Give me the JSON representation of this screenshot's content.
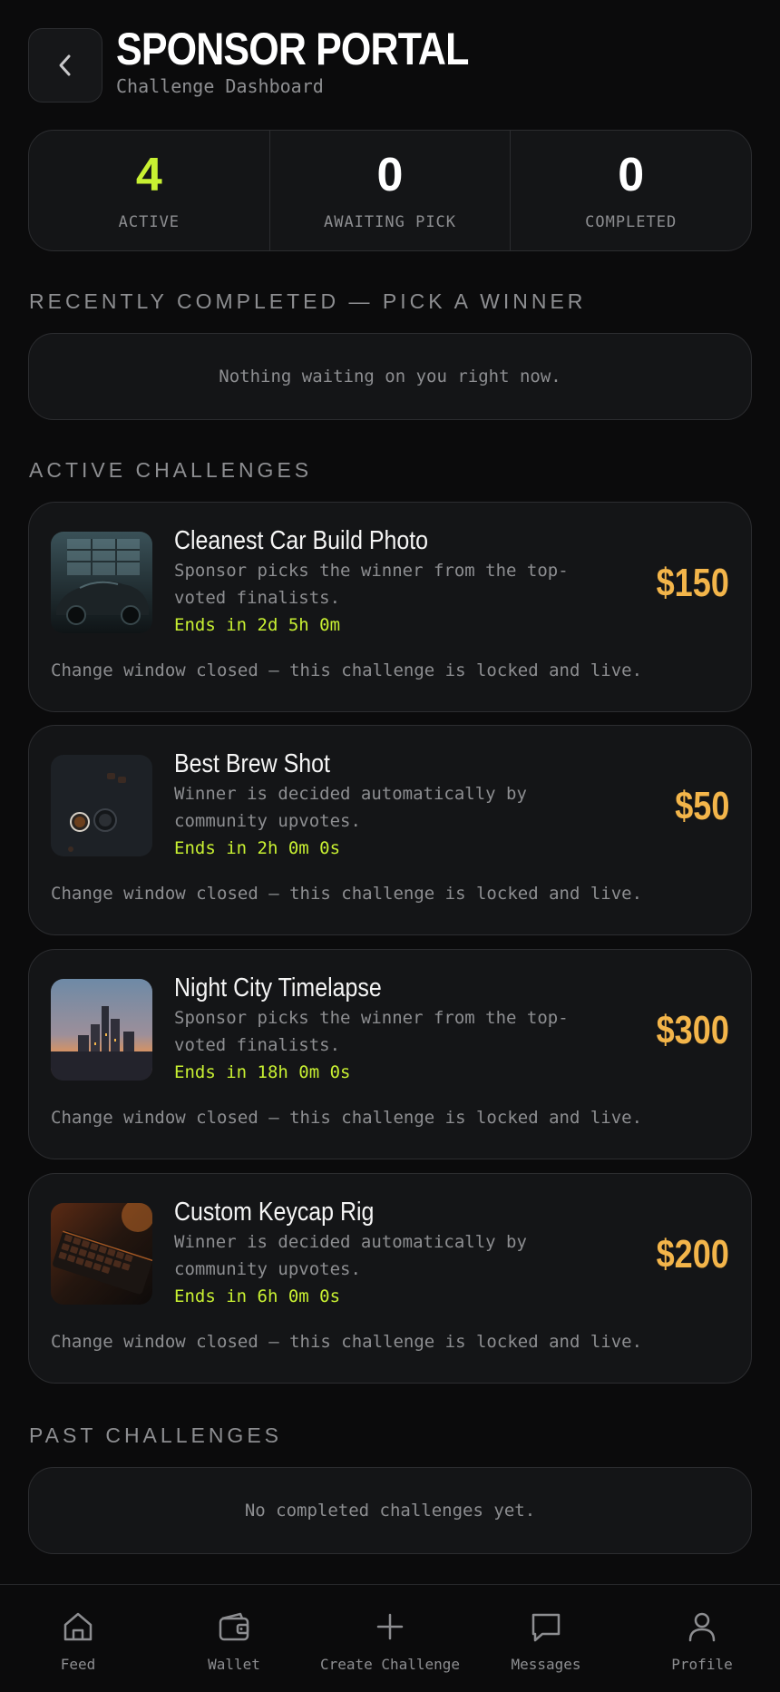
{
  "header": {
    "title": "SPONSOR PORTAL",
    "subtitle": "Challenge Dashboard"
  },
  "stats": [
    {
      "value": "4",
      "label": "ACTIVE"
    },
    {
      "value": "0",
      "label": "AWAITING PICK"
    },
    {
      "value": "0",
      "label": "COMPLETED"
    }
  ],
  "sections": {
    "recently_completed": {
      "title": "RECENTLY COMPLETED — PICK A WINNER",
      "empty_text": "Nothing waiting on you right now."
    },
    "active": {
      "title": "ACTIVE CHALLENGES"
    },
    "past": {
      "title": "PAST CHALLENGES",
      "empty_text": "No completed challenges yet."
    }
  },
  "challenges": [
    {
      "title": "Cleanest Car Build Photo",
      "description": "Sponsor picks the winner from the top-voted finalists.",
      "timer": "Ends in 2d 5h 0m",
      "prize": "$150",
      "note": "Change window closed — this challenge is locked and live."
    },
    {
      "title": "Best Brew Shot",
      "description": "Winner is decided automatically by community upvotes.",
      "timer": "Ends in 2h 0m 0s",
      "prize": "$50",
      "note": "Change window closed — this challenge is locked and live."
    },
    {
      "title": "Night City Timelapse",
      "description": "Sponsor picks the winner from the top-voted finalists.",
      "timer": "Ends in 18h 0m 0s",
      "prize": "$300",
      "note": "Change window closed — this challenge is locked and live."
    },
    {
      "title": "Custom Keycap Rig",
      "description": "Winner is decided automatically by community upvotes.",
      "timer": "Ends in 6h 0m 0s",
      "prize": "$200",
      "note": "Change window closed — this challenge is locked and live."
    }
  ],
  "nav": [
    {
      "label": "Feed",
      "icon": "home-icon"
    },
    {
      "label": "Wallet",
      "icon": "wallet-icon"
    },
    {
      "label": "Create Challenge",
      "icon": "plus-icon"
    },
    {
      "label": "Messages",
      "icon": "chat-icon"
    },
    {
      "label": "Profile",
      "icon": "user-icon"
    }
  ],
  "colors": {
    "background": "#0b0b0c",
    "card": "#141517",
    "accent": "#c8f032",
    "prize": "#f3b54a",
    "muted": "#8d8e91"
  }
}
